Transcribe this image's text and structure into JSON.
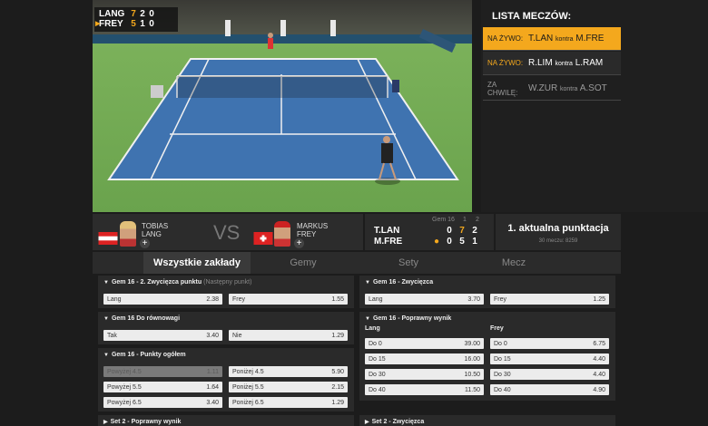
{
  "score_overlay": {
    "rows": [
      {
        "name": "LANG",
        "games": "7",
        "s1": "2",
        "s2": "0",
        "serving": false
      },
      {
        "name": "FREY",
        "games": "5",
        "s1": "1",
        "s2": "0",
        "serving": true
      }
    ]
  },
  "match_list": {
    "title": "LISTA MECZÓW:",
    "items": [
      {
        "status": "NA ŻYWO:",
        "home": "T.LAN",
        "sep": "kontra",
        "away": "M.FRE"
      },
      {
        "status": "NA ŻYWO:",
        "home": "R.LIM",
        "sep": "kontra",
        "away": "L.RAM"
      },
      {
        "status": "ZA CHWILĘ:",
        "home": "W.ZUR",
        "sep": "kontra",
        "away": "A.SOT"
      }
    ]
  },
  "players": {
    "left": {
      "first": "TOBIAS",
      "last": "LANG"
    },
    "vs": "VS",
    "right": {
      "first": "MARKUS",
      "last": "FREY"
    }
  },
  "scoreboard": {
    "header_game": "Gem 16",
    "header_s1": "1",
    "header_s2": "2",
    "rows": [
      {
        "name": "T.LAN",
        "serve": "",
        "game": "0",
        "s1": "7",
        "s2": "2"
      },
      {
        "name": "M.FRE",
        "serve": "●",
        "game": "0",
        "s1": "5",
        "s2": "1"
      }
    ]
  },
  "point_info": {
    "title": "1. aktualna punktacja",
    "subtitle": "30 meczu: 8259"
  },
  "tabs": [
    "Wszystkie zakłady",
    "Gemy",
    "Sety",
    "Mecz"
  ],
  "markets": {
    "m1": {
      "title": "Gem 16 - 2. Zwycięzca punktu",
      "hint": "(Następny punkt)",
      "odds": [
        {
          "label": "Lang",
          "value": "2.38"
        },
        {
          "label": "Frey",
          "value": "1.55"
        }
      ]
    },
    "m2": {
      "title": "Gem 16 Do równowagi",
      "odds": [
        {
          "label": "Tak",
          "value": "3.40"
        },
        {
          "label": "Nie",
          "value": "1.29"
        }
      ]
    },
    "m3": {
      "title": "Gem 16 - Punkty ogółem",
      "odds": [
        {
          "label": "Powyżej 4.5",
          "value": "1.11"
        },
        {
          "label": "Poniżej 4.5",
          "value": "5.90"
        },
        {
          "label": "Powyżej 5.5",
          "value": "1.64"
        },
        {
          "label": "Poniżej 5.5",
          "value": "2.15"
        },
        {
          "label": "Powyżej 6.5",
          "value": "3.40"
        },
        {
          "label": "Poniżej 6.5",
          "value": "1.29"
        }
      ]
    },
    "m4": {
      "title": "Set 2 - Poprawny wynik"
    },
    "m5": {
      "title": "Gem 16 - Zwycięzca",
      "odds": [
        {
          "label": "Lang",
          "value": "3.70"
        },
        {
          "label": "Frey",
          "value": "1.25"
        }
      ]
    },
    "m6": {
      "title": "Gem 16 - Poprawny wynik",
      "col_left": "Lang",
      "col_right": "Frey",
      "odds": [
        {
          "label": "Do 0",
          "value": "39.00"
        },
        {
          "label": "Do 0",
          "value": "6.75"
        },
        {
          "label": "Do 15",
          "value": "16.00"
        },
        {
          "label": "Do 15",
          "value": "4.40"
        },
        {
          "label": "Do 30",
          "value": "10.50"
        },
        {
          "label": "Do 30",
          "value": "4.40"
        },
        {
          "label": "Do 40",
          "value": "11.50"
        },
        {
          "label": "Do 40",
          "value": "4.90"
        }
      ]
    },
    "m7": {
      "title": "Set 2 - Zwycięzca"
    }
  },
  "colors": {
    "accent": "#f4a81d",
    "panel": "#2a2a2a",
    "odds_bg": "#ececec"
  }
}
